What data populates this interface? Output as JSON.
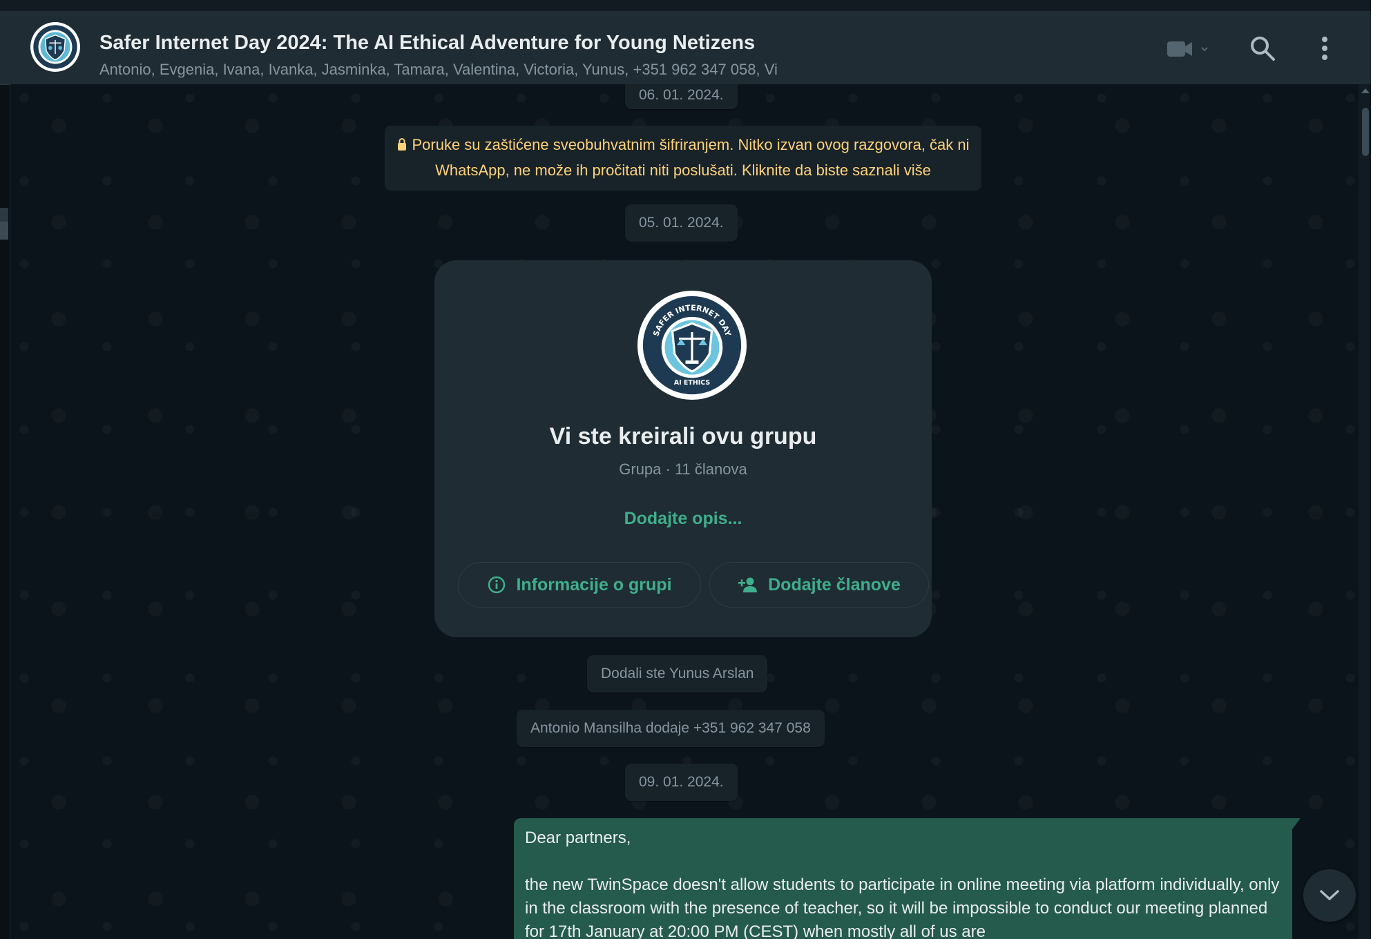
{
  "header": {
    "title": "Safer Internet Day 2024: The AI Ethical Adventure for Young Netizens",
    "members": "Antonio, Evgenia, Ivana, Ivanka, Jasminka, Tamara, Valentina, Victoria, Yunus, +351 962 347 058, Vi",
    "icons": [
      "video-call-icon",
      "search-icon",
      "menu-icon"
    ]
  },
  "chat": {
    "date_1": "06. 01. 2024.",
    "encryption_notice": "Poruke su zaštićene sveobuhvatnim šifriranjem. Nitko izvan ovog razgovora, čak ni WhatsApp, ne može ih pročitati niti poslušati. Kliknite da biste saznali više",
    "date_2": "05. 01. 2024.",
    "group_card": {
      "title": "Vi ste kreirali ovu grupu",
      "subtitle": "Grupa · 11 članova",
      "add_description": "Dodajte opis...",
      "group_info_button": "Informacije o grupi",
      "add_members_button": "Dodajte članove"
    },
    "system_1": "Dodali ste Yunus Arslan",
    "system_2": "Antonio Mansilha dodaje +351 962 347 058",
    "date_3": "09. 01. 2024.",
    "message": {
      "line_1": "Dear partners,",
      "line_2": "the new TwinSpace doesn't allow students to participate in online meeting via platform individually, only in the classroom with the presence of teacher, so it will be impossible to conduct our meeting planned for 17th January at 20:00 PM (CEST) when mostly all of us are"
    }
  },
  "badge_text": {
    "top": "SAFER INTERNET DAY",
    "bottom": "AI ETHICS"
  },
  "colors": {
    "header_bg": "#202c33",
    "chat_bg": "#0b141a",
    "accent_green": "#3fae8c",
    "outgoing_bubble": "#255b4c",
    "encryption_text": "#ffd279"
  }
}
